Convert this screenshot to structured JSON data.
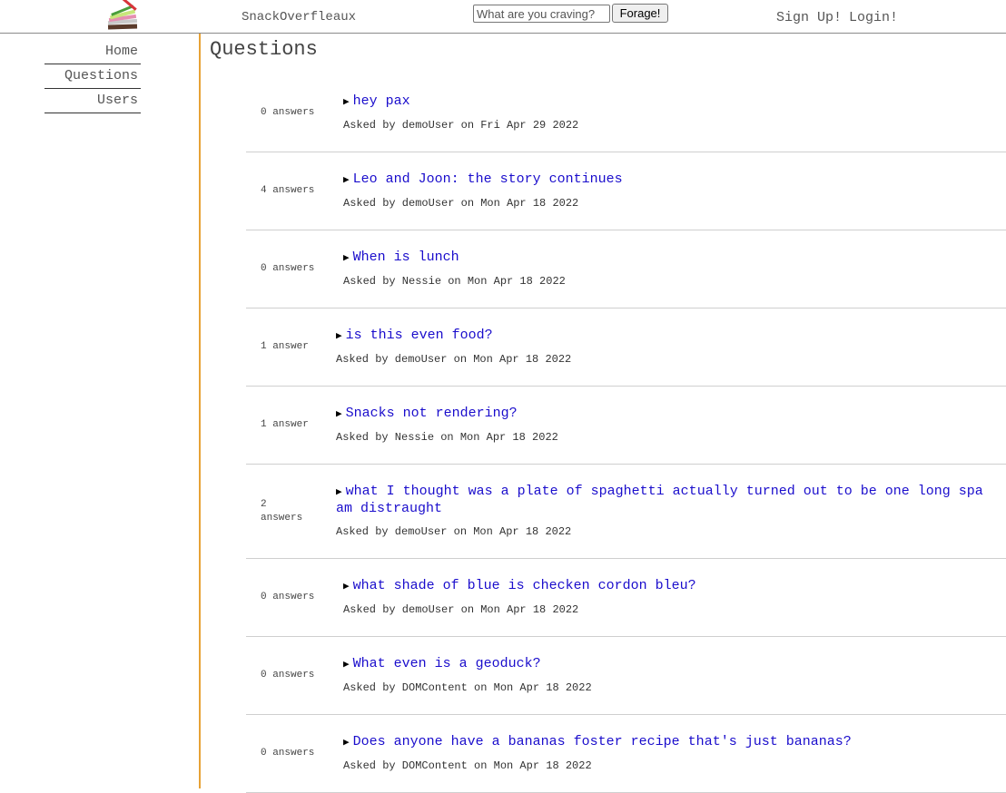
{
  "header": {
    "site_name": "SnackOverfleaux",
    "search_placeholder": "What are you craving?",
    "search_button": "Forage!",
    "signup": "Sign Up!",
    "login": "Login!"
  },
  "sidebar": {
    "items": [
      {
        "label": "Home"
      },
      {
        "label": "Questions"
      },
      {
        "label": "Users"
      }
    ]
  },
  "main": {
    "title": "Questions",
    "questions": [
      {
        "count": "0 answers",
        "title": "hey pax",
        "meta": "Asked by demoUser on Fri Apr 29 2022"
      },
      {
        "count": "4 answers",
        "title": "Leo and Joon: the story continues",
        "meta": "Asked by demoUser on Mon Apr 18 2022"
      },
      {
        "count": "0 answers",
        "title": "When is lunch",
        "meta": "Asked by Nessie on Mon Apr 18 2022"
      },
      {
        "count": "1 answer",
        "title": "is this even food?",
        "meta": "Asked by demoUser on Mon Apr 18 2022"
      },
      {
        "count": "1 answer",
        "title": "Snacks not rendering?",
        "meta": "Asked by Nessie on Mon Apr 18 2022"
      },
      {
        "count": "2 answers",
        "title": "what I thought was a plate of spaghetti actually turned out to be one long spa",
        "title_cont": "am distraught",
        "meta": "Asked by demoUser on Mon Apr 18 2022"
      },
      {
        "count": "0 answers",
        "title": "what shade of blue is checken cordon bleu?",
        "meta": "Asked by demoUser on Mon Apr 18 2022"
      },
      {
        "count": "0 answers",
        "title": "What even is a geoduck?",
        "meta": "Asked by DOMContent on Mon Apr 18 2022"
      },
      {
        "count": "0 answers",
        "title": "Does anyone have a bananas foster recipe that's just bananas?",
        "meta": "Asked by DOMContent on Mon Apr 18 2022"
      }
    ]
  },
  "colors": {
    "accent": "#e7a236",
    "link": "#1a0dcc"
  },
  "icons": {
    "logo": "stacked-snacks-logo-icon",
    "expand": "disclosure-triangle-icon"
  }
}
